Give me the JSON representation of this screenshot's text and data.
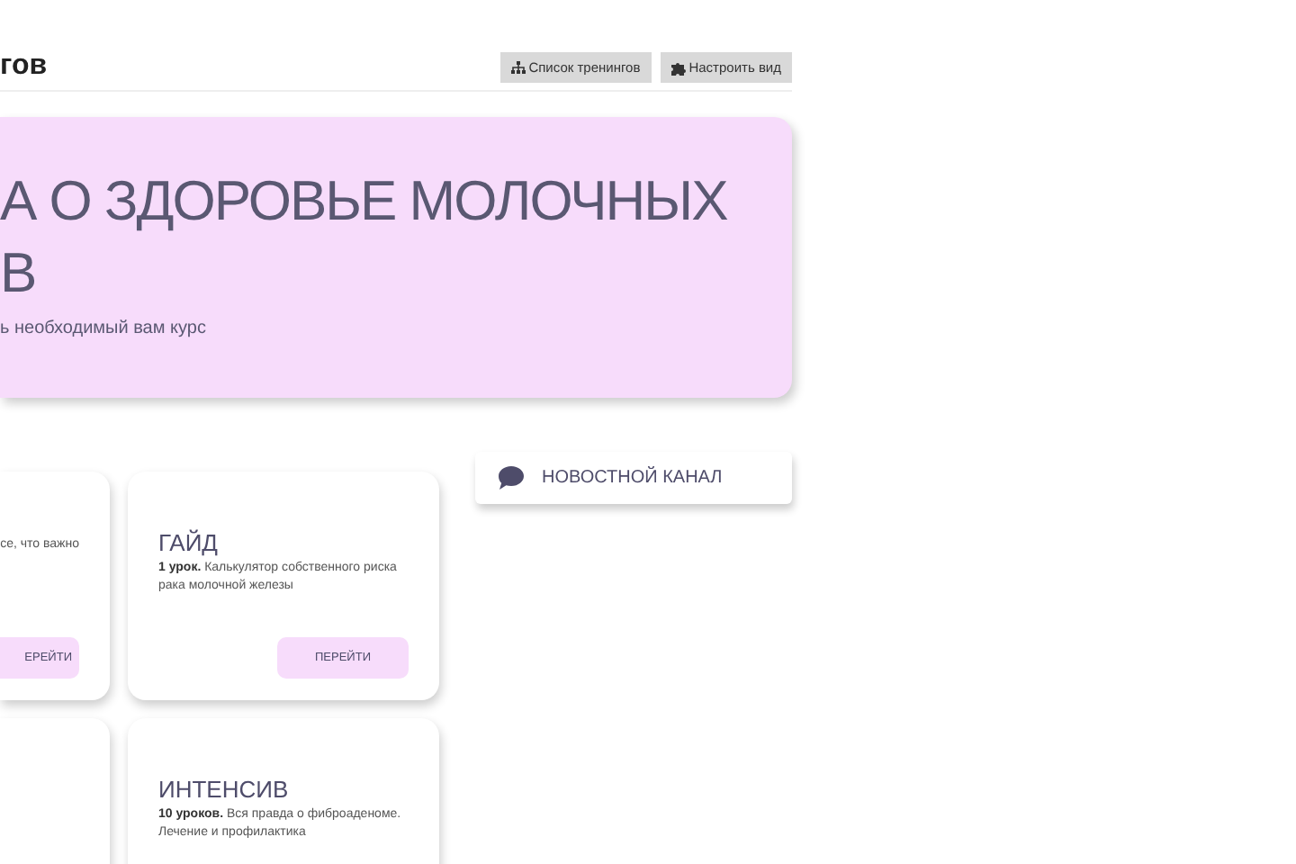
{
  "header": {
    "title": "гов",
    "buttons": [
      "Список тренингов",
      "Настроить вид"
    ]
  },
  "hero": {
    "title_lines": [
      "А О ЗДОРОВЬЕ МОЛОЧНЫХ",
      "В"
    ],
    "subtitle": "ь необходимый вам курс"
  },
  "courses": [
    {
      "kind": "course",
      "text": "се, что важно",
      "button": "ЕРЕЙТИ"
    },
    {
      "kind": "course",
      "title": "ГАЙД",
      "text": "**1 урок.** Калькулятор собственного риска рака молочной железы",
      "button": "ПЕРЕЙТИ"
    },
    {
      "kind": "blank"
    },
    {
      "kind": "course",
      "title": "ИНТЕНСИВ",
      "text": "**10 уроков.** Вся правда о фиброаденоме. Лечение и профилактика"
    }
  ],
  "news": {
    "label": "НОВОСТНОЙ КАНАЛ"
  }
}
